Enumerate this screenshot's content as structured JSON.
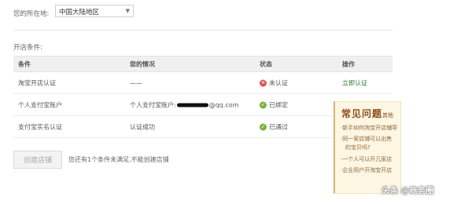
{
  "location": {
    "label": "您的所在地:",
    "selected": "中国大陆地区"
  },
  "conditions_title": "开店条件:",
  "table": {
    "headers": [
      "条件",
      "您的情况",
      "状态",
      "操作"
    ],
    "rows": [
      {
        "condition": "淘宝开店认证",
        "situation": "——",
        "status": "未认证",
        "status_type": "error",
        "action": "立即认证"
      },
      {
        "condition": "个人支付宝账户",
        "situation_prefix": "个人支付宝账户:",
        "situation_suffix": "@qq.com",
        "status": "已绑定",
        "status_type": "ok",
        "action": ""
      },
      {
        "condition": "支付宝实名认证",
        "situation": "认证成功",
        "status": "已通过",
        "status_type": "ok",
        "action": ""
      }
    ]
  },
  "faq": {
    "title": "常见问题",
    "title_suffix": "其他",
    "items": [
      {
        "text": "·新手如何淘宝开店辅导",
        "text2": ""
      },
      {
        "text": "·同一家店铺可以出售",
        "text2": "的宝贝吗?"
      },
      {
        "text": "·一个人可以开几家店",
        "text2": ""
      },
      {
        "text": "·企业用户开淘宝开店",
        "text2": ""
      }
    ]
  },
  "create_button": "创建店铺",
  "notice": "您还有1个条件未满足,不能创建店铺",
  "watermark": "头条 @商务圈",
  "colors": {
    "accent_green": "#2e7d32",
    "error_red": "#d9534f",
    "ok_green": "#7ab23a"
  }
}
